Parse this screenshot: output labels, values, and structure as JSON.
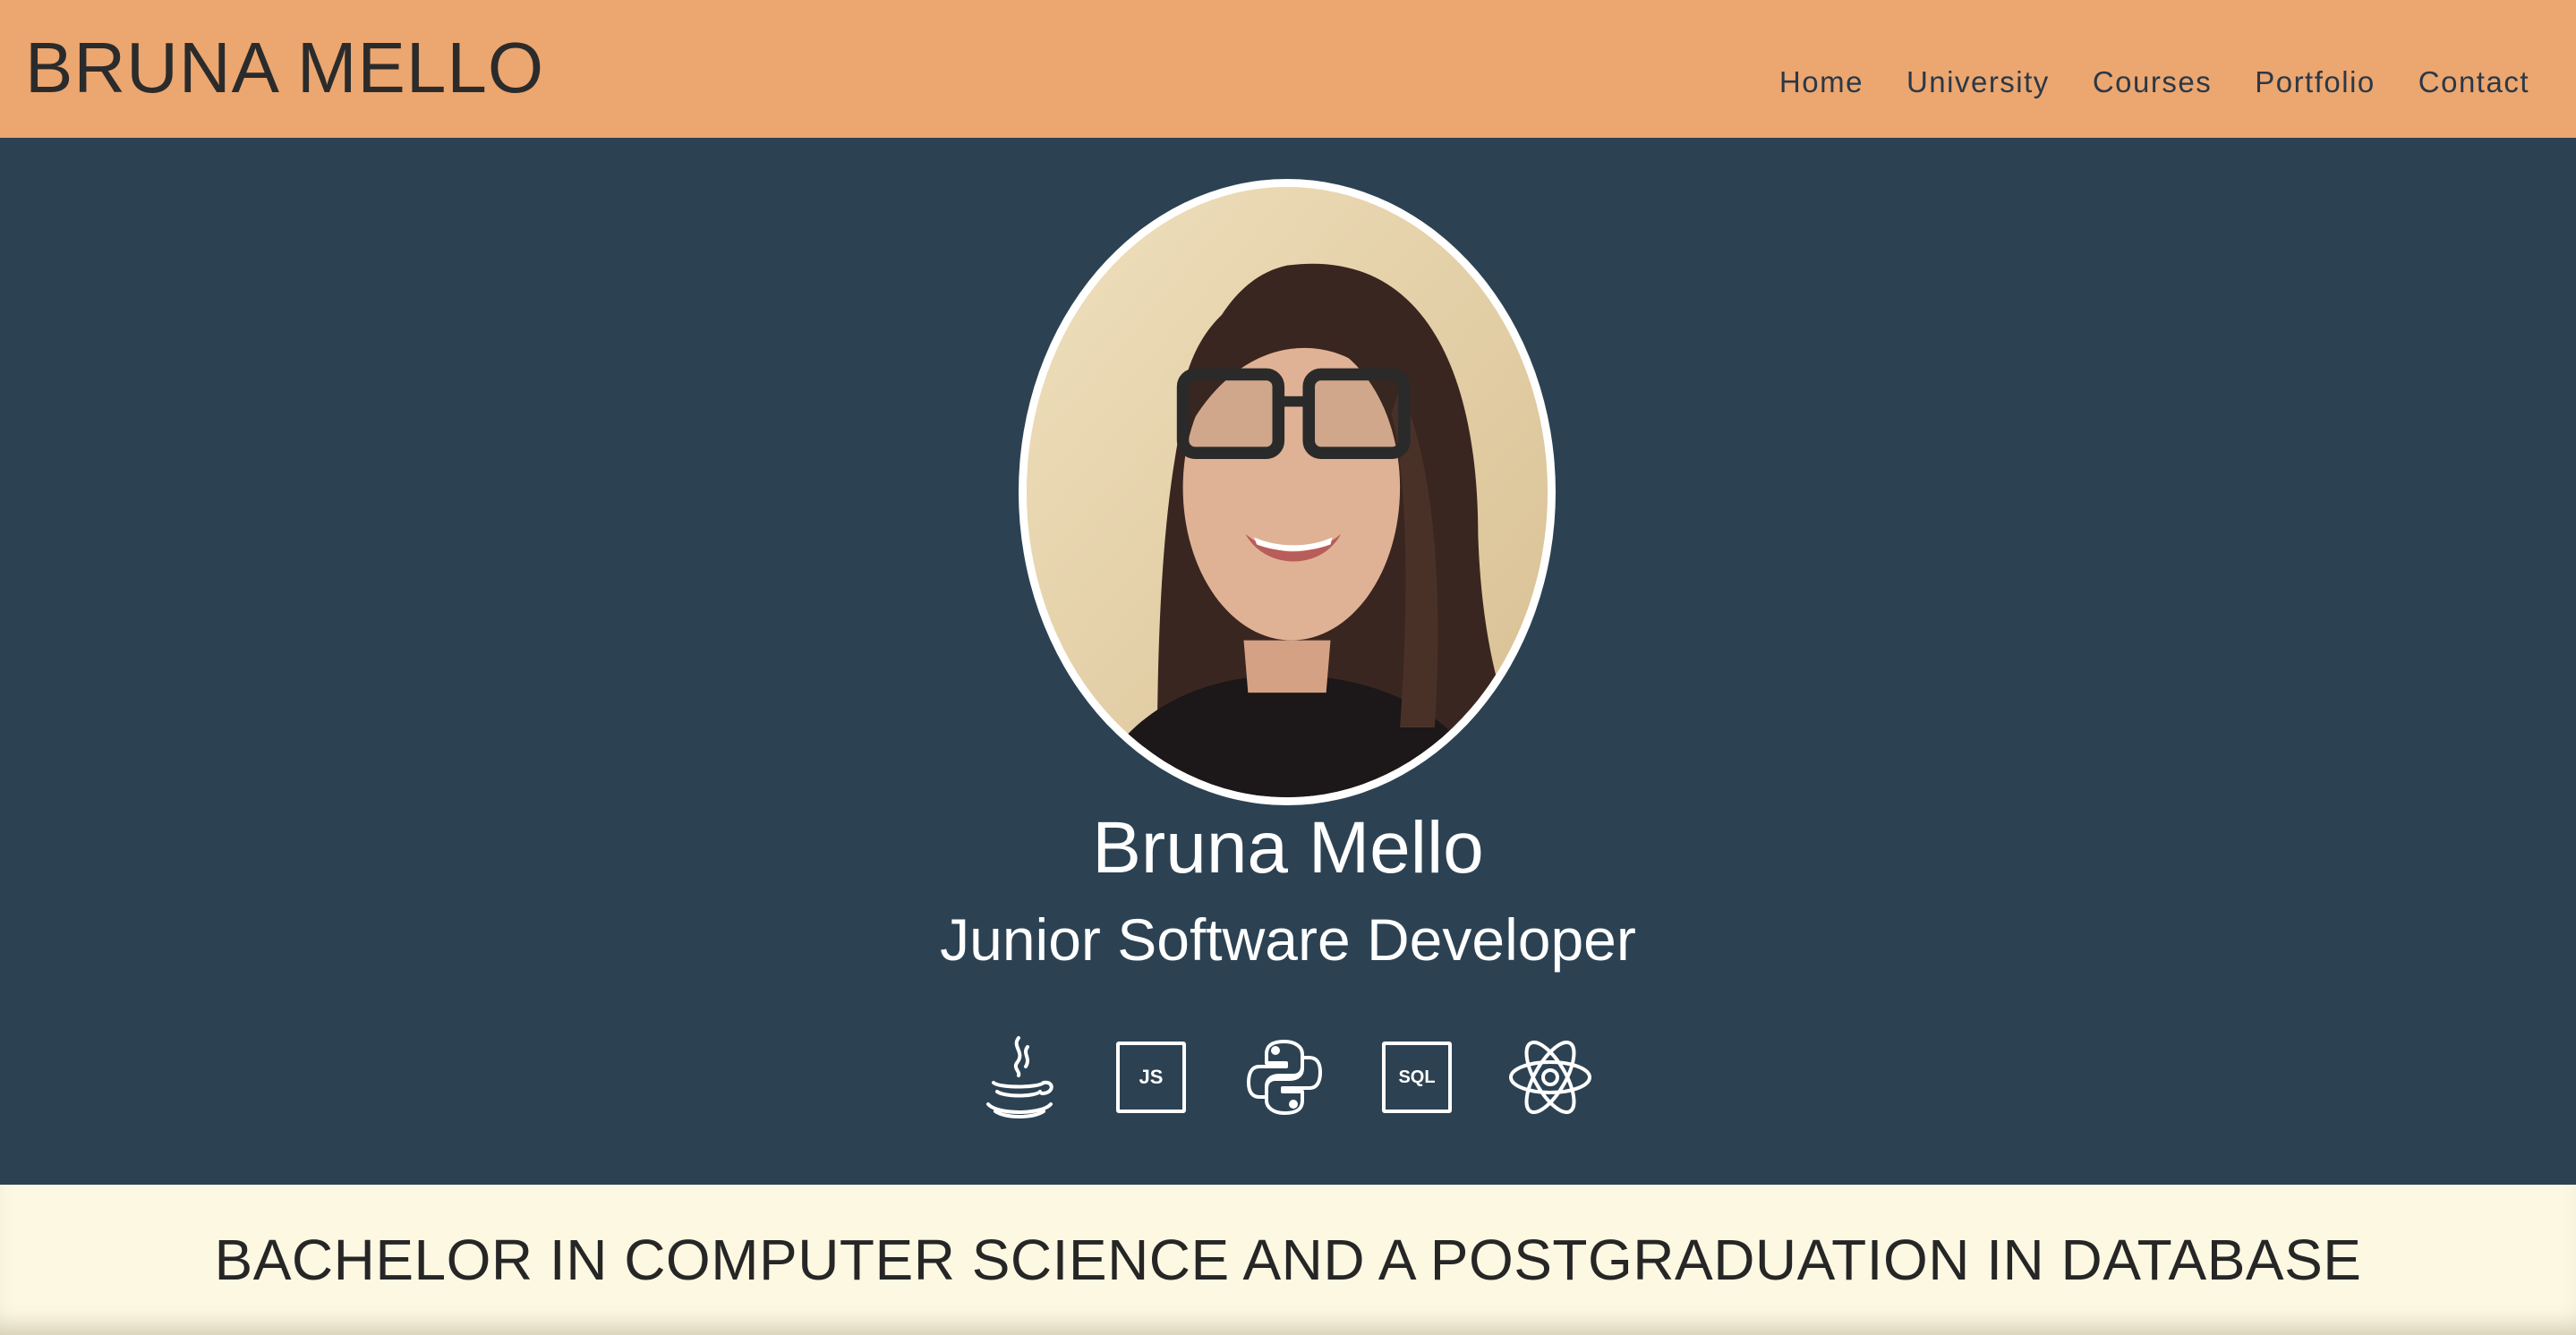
{
  "header": {
    "brand": "BRUNA MELLO",
    "nav": [
      "Home",
      "University",
      "Courses",
      "Portfolio",
      "Contact"
    ]
  },
  "profile": {
    "name": "Bruna Mello",
    "role": "Junior Software Developer",
    "photo_icon": "profile-photo"
  },
  "skills": [
    {
      "icon": "java-icon"
    },
    {
      "icon": "javascript-icon",
      "label": "JS"
    },
    {
      "icon": "python-icon"
    },
    {
      "icon": "sql-icon",
      "label": "SQL"
    },
    {
      "icon": "react-icon"
    }
  ],
  "banner": {
    "text": "BACHELOR IN COMPUTER SCIENCE AND A POSTGRADUATION IN DATABASE"
  },
  "colors": {
    "header_bg": "#eca66f",
    "hero_bg": "#2c4253",
    "banner_bg": "#fdf8e2",
    "text_dark": "#2b2b2b",
    "text_light": "#ffffff"
  }
}
